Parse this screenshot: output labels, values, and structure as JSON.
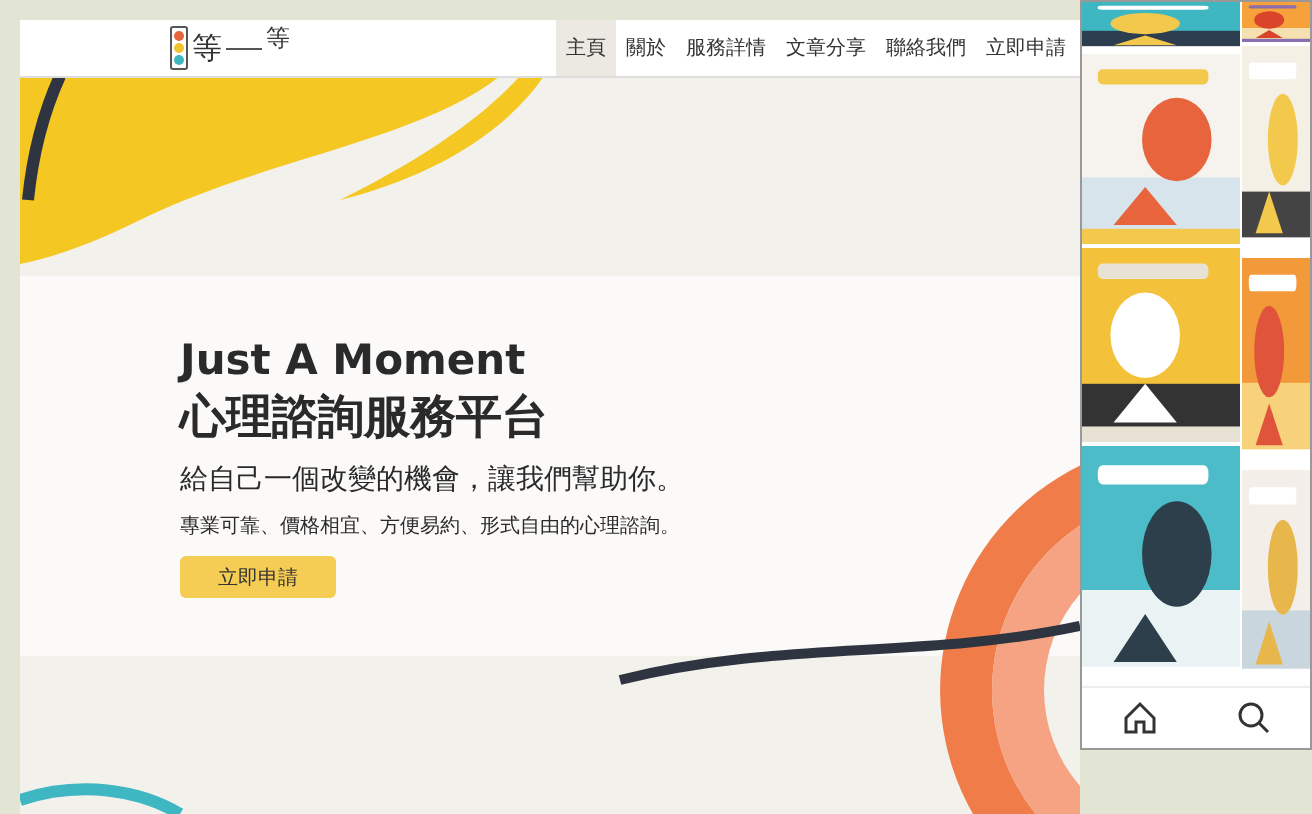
{
  "site": {
    "logo": {
      "chars": [
        "等",
        "等"
      ]
    },
    "nav": [
      {
        "label": "主頁",
        "selected": true
      },
      {
        "label": "關於",
        "selected": false
      },
      {
        "label": "服務詳情",
        "selected": false
      },
      {
        "label": "文章分享",
        "selected": false
      },
      {
        "label": "聯絡我們",
        "selected": false
      },
      {
        "label": "立即申請",
        "selected": false
      }
    ],
    "hero": {
      "title": "Just A Moment",
      "subtitle": "心理諮詢服務平台",
      "tagline": "給自己一個改變的機會，讓我們幫助你。",
      "description": "專業可靠、價格相宜、方便易約、形式自由的心理諮詢。",
      "button": "立即申請"
    }
  }
}
